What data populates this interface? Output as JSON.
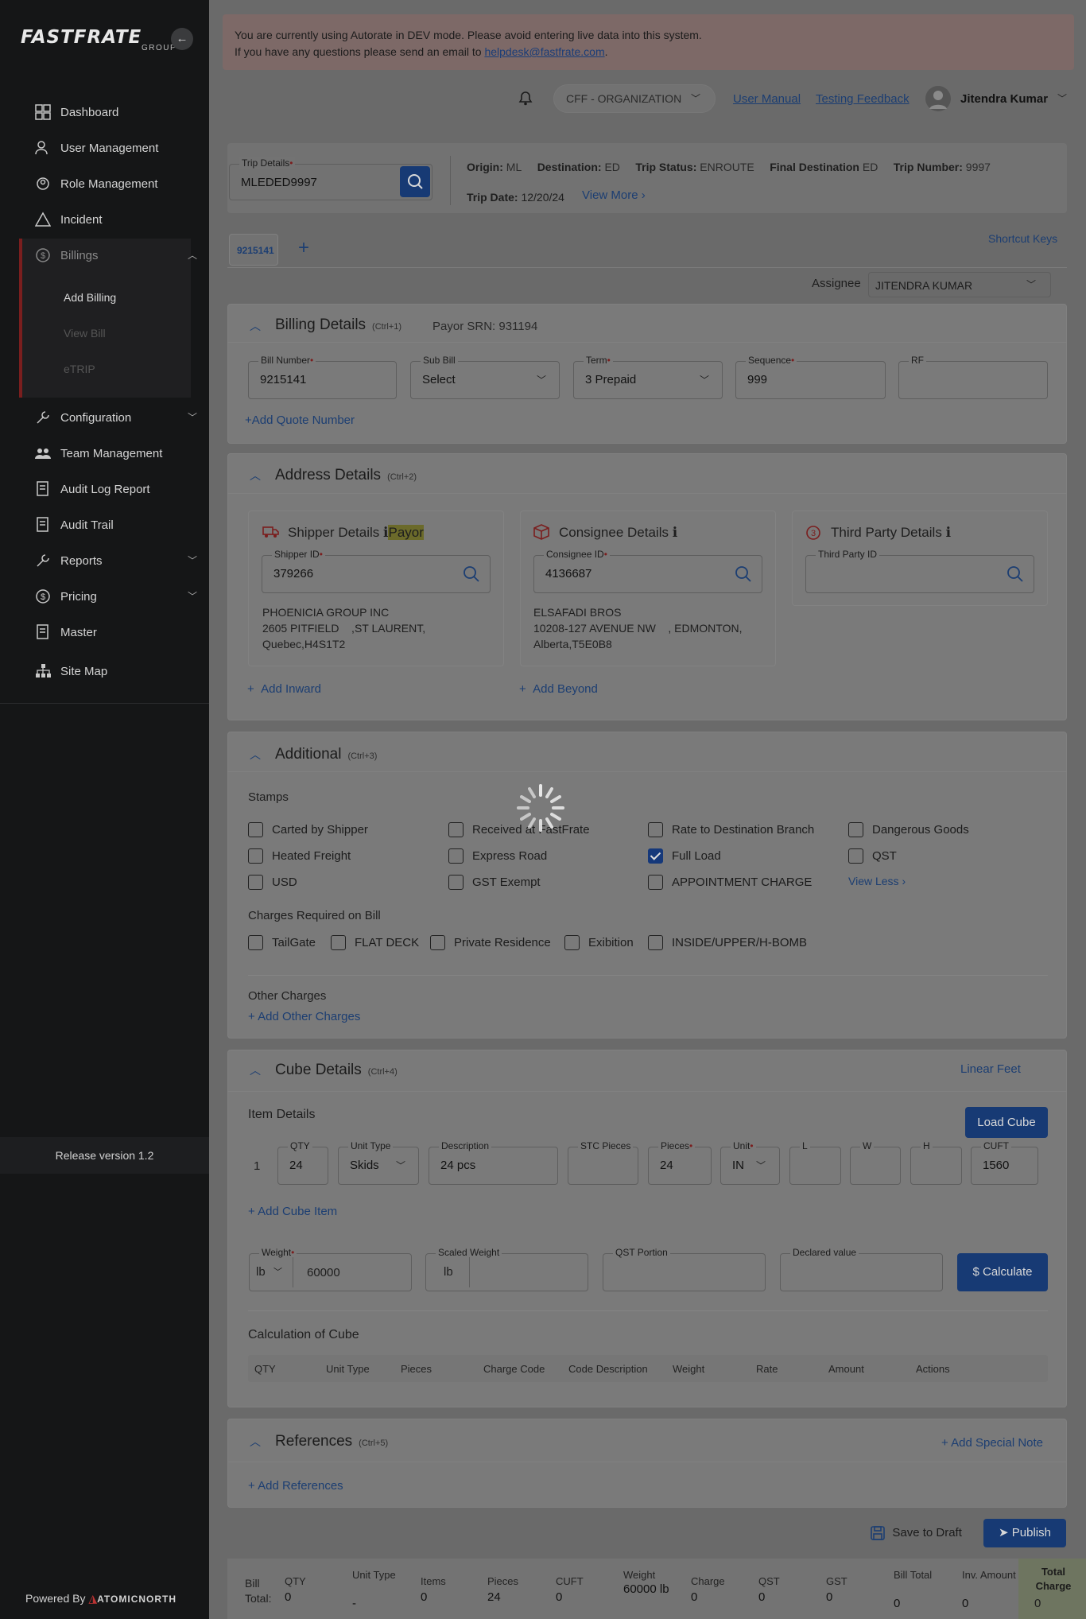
{
  "sidebar": {
    "logo": "FASTFRATE",
    "logo_sub": "GROUP",
    "items": [
      {
        "label": "Dashboard"
      },
      {
        "label": "User Management"
      },
      {
        "label": "Role Management"
      },
      {
        "label": "Incident"
      },
      {
        "label": "Billings"
      },
      {
        "label": "Configuration"
      },
      {
        "label": "Team Management"
      },
      {
        "label": "Audit Log Report"
      },
      {
        "label": "Audit Trail"
      },
      {
        "label": "Reports"
      },
      {
        "label": "Pricing"
      },
      {
        "label": "Master"
      },
      {
        "label": "Site Map"
      }
    ],
    "billing_sub": [
      "Add Billing",
      "View Bill",
      "eTRIP"
    ],
    "release": "Release version 1.2",
    "powered": "Powered By",
    "powered_brand": "ATOMICNORTH"
  },
  "banner": {
    "line1": "You are currently using Autorate in DEV mode. Please avoid entering live data into this system.",
    "line2": "If you have any questions please send an email to ",
    "email": "helpdesk@fastfrate.com",
    "line2_end": "."
  },
  "header": {
    "org": "CFF - ORGANIZATION",
    "user_manual": "User Manual",
    "testing_feedback": "Testing Feedback",
    "user": "Jitendra Kumar"
  },
  "trip": {
    "label": "Trip Details",
    "value": "MLEDED9997",
    "origin_k": "Origin:",
    "origin_v": "ML",
    "dest_k": "Destination:",
    "dest_v": "ED",
    "status_k": "Trip Status:",
    "status_v": "ENROUTE",
    "final_k": "Final Destination",
    "final_v": "ED",
    "num_k": "Trip Number:",
    "num_v": "9997",
    "date_k": "Trip Date:",
    "date_v": "12/20/24",
    "view_more": "View More"
  },
  "tabs": {
    "active": "9215141",
    "add": "+",
    "shortcut": "Shortcut Keys"
  },
  "assignee": {
    "label": "Assignee",
    "value": "JITENDRA KUMAR"
  },
  "billing": {
    "title": "Billing Details",
    "key": "(Ctrl+1)",
    "payor_srn": "Payor SRN: 931194",
    "bill_number_label": "Bill Number",
    "bill_number": "9215141",
    "sub_bill_label": "Sub Bill",
    "sub_bill": "Select",
    "term_label": "Term",
    "term": "3 Prepaid",
    "sequence_label": "Sequence",
    "sequence": "999",
    "rf_label": "RF",
    "add_quote": "+Add Quote Number"
  },
  "address": {
    "title": "Address Details",
    "key": "(Ctrl+2)",
    "shipper": {
      "title": "Shipper Details",
      "payor": "Payor",
      "id_label": "Shipper ID",
      "id": "379266",
      "name": "PHOENICIA GROUP INC",
      "addr1": "2605 PITFIELD    ,ST LAURENT,",
      "addr2": "Quebec,H4S1T2"
    },
    "consignee": {
      "title": "Consignee Details",
      "id_label": "Consignee ID",
      "id": "4136687",
      "name": "ELSAFADI BROS",
      "addr1": "10208-127 AVENUE NW    , EDMONTON,",
      "addr2": "Alberta,T5E0B8"
    },
    "third": {
      "title": "Third Party Details",
      "id_label": "Third Party ID"
    },
    "add_inward": "Add Inward",
    "add_beyond": "Add Beyond"
  },
  "additional": {
    "title": "Additional",
    "key": "(Ctrl+3)",
    "stamps_label": "Stamps",
    "stamps": [
      {
        "label": "Carted by Shipper",
        "checked": false
      },
      {
        "label": "Received at FastFrate",
        "checked": false
      },
      {
        "label": "Rate to Destination Branch",
        "checked": false
      },
      {
        "label": "Dangerous Goods",
        "checked": false
      },
      {
        "label": "Heated Freight",
        "checked": false
      },
      {
        "label": "Express Road",
        "checked": false
      },
      {
        "label": "Full Load",
        "checked": true
      },
      {
        "label": "QST",
        "checked": false
      },
      {
        "label": "USD",
        "checked": false
      },
      {
        "label": "GST Exempt",
        "checked": false
      },
      {
        "label": "APPOINTMENT CHARGE",
        "checked": false
      }
    ],
    "view_less": "View Less",
    "charges_label": "Charges Required on Bill",
    "charges": [
      "TailGate",
      "FLAT DECK",
      "Private Residence",
      "Exibition",
      "INSIDE/UPPER/H-BOMB"
    ],
    "other_label": "Other Charges",
    "add_other": "Add Other Charges"
  },
  "cube": {
    "title": "Cube Details",
    "key": "(Ctrl+4)",
    "linear_feet": "Linear Feet",
    "item_details": "Item Details",
    "load_cube": "Load Cube",
    "row": {
      "index": "1",
      "qty_label": "QTY",
      "qty": "24",
      "unit_type_label": "Unit Type",
      "unit_type": "Skids",
      "desc_label": "Description",
      "desc": "24 pcs",
      "stc_label": "STC Pieces",
      "pieces_label": "Pieces",
      "pieces": "24",
      "unit_label": "Unit",
      "unit": "IN",
      "l_label": "L",
      "w_label": "W",
      "h_label": "H",
      "cuft_label": "CUFT",
      "cuft": "1560"
    },
    "add_item": "+ Add Cube Item",
    "weight_label": "Weight",
    "weight_unit": "lb",
    "weight": "60000",
    "scaled_label": "Scaled Weight",
    "scaled_unit": "lb",
    "qst_label": "QST Portion",
    "declared_label": "Declared value",
    "calculate": "Calculate",
    "calc_title": "Calculation of Cube",
    "calc_headers": [
      "QTY",
      "Unit Type",
      "Pieces",
      "Charge Code",
      "Code Description",
      "Weight",
      "Rate",
      "Amount",
      "Actions"
    ]
  },
  "references": {
    "title": "References",
    "key": "(Ctrl+5)",
    "add_special": "Add Special Note",
    "add_refs": "Add References"
  },
  "actions": {
    "save_draft": "Save to Draft",
    "publish": "Publish"
  },
  "totals": {
    "label1": "Bill",
    "label2": "Total:",
    "cols": [
      {
        "k": "QTY",
        "v": "0"
      },
      {
        "k": "Unit Type",
        "v": "-"
      },
      {
        "k": "Items",
        "v": "0"
      },
      {
        "k": "Pieces",
        "v": "24"
      },
      {
        "k": "CUFT",
        "v": "0"
      },
      {
        "k": "Weight",
        "v": "60000 lb"
      },
      {
        "k": "Charge",
        "v": "0"
      },
      {
        "k": "QST",
        "v": "0"
      },
      {
        "k": "GST",
        "v": "0"
      },
      {
        "k": "Bill Total",
        "v": "0"
      },
      {
        "k": "Inv. Amount",
        "v": "0"
      }
    ],
    "total_charge_label": "Total Charge",
    "total_charge": "0"
  }
}
